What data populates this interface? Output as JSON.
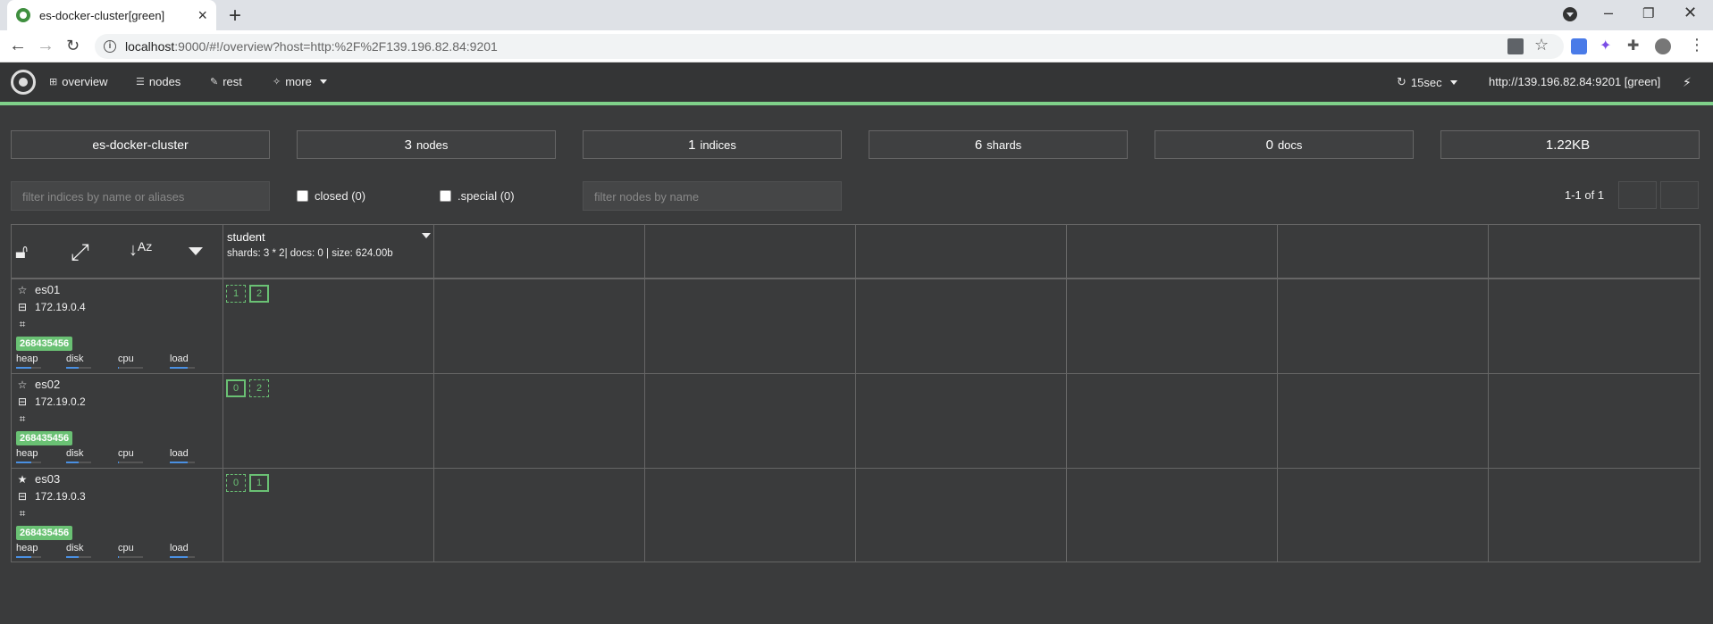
{
  "browser": {
    "tab_title": "es-docker-cluster[green]",
    "url_host": "localhost",
    "url_rest": ":9000/#!/overview?host=http:%2F%2F139.196.82.84:9201"
  },
  "nav": {
    "overview": "overview",
    "nodes": "nodes",
    "rest": "rest",
    "more": "more",
    "refresh": "15sec",
    "host": "http://139.196.82.84:9201 [green]"
  },
  "stats": {
    "cluster_name": "es-docker-cluster",
    "nodes_count": "3",
    "nodes_label": "nodes",
    "indices_count": "1",
    "indices_label": "indices",
    "shards_count": "6",
    "shards_label": "shards",
    "docs_count": "0",
    "docs_label": "docs",
    "size": "1.22KB"
  },
  "filters": {
    "indices_placeholder": "filter indices by name or aliases",
    "closed_label": "closed (0)",
    "special_label": ".special (0)",
    "nodes_placeholder": "filter nodes by name",
    "pager": "1-1 of 1"
  },
  "index": {
    "name": "student",
    "meta": "shards: 3 * 2| docs: 0 | size: 624.00b"
  },
  "nodes": [
    {
      "name": "es01",
      "ip": "172.19.0.4",
      "badge": "268435456",
      "master": false,
      "shards": [
        {
          "n": "1",
          "primary": false
        },
        {
          "n": "2",
          "primary": true
        }
      ],
      "heap": 0.6,
      "disk": 0.5,
      "cpu": 0.05,
      "load": 0.7
    },
    {
      "name": "es02",
      "ip": "172.19.0.2",
      "badge": "268435456",
      "master": false,
      "shards": [
        {
          "n": "0",
          "primary": true
        },
        {
          "n": "2",
          "primary": false
        }
      ],
      "heap": 0.6,
      "disk": 0.5,
      "cpu": 0.05,
      "load": 0.7
    },
    {
      "name": "es03",
      "ip": "172.19.0.3",
      "badge": "268435456",
      "master": true,
      "shards": [
        {
          "n": "0",
          "primary": false
        },
        {
          "n": "1",
          "primary": true
        }
      ],
      "heap": 0.6,
      "disk": 0.5,
      "cpu": 0.05,
      "load": 0.7
    }
  ],
  "metrics": {
    "heap": "heap",
    "disk": "disk",
    "cpu": "cpu",
    "load": "load"
  },
  "colors": {
    "green": "#6ac174",
    "bar": "#4a90e2",
    "background": "#3a3b3c"
  }
}
